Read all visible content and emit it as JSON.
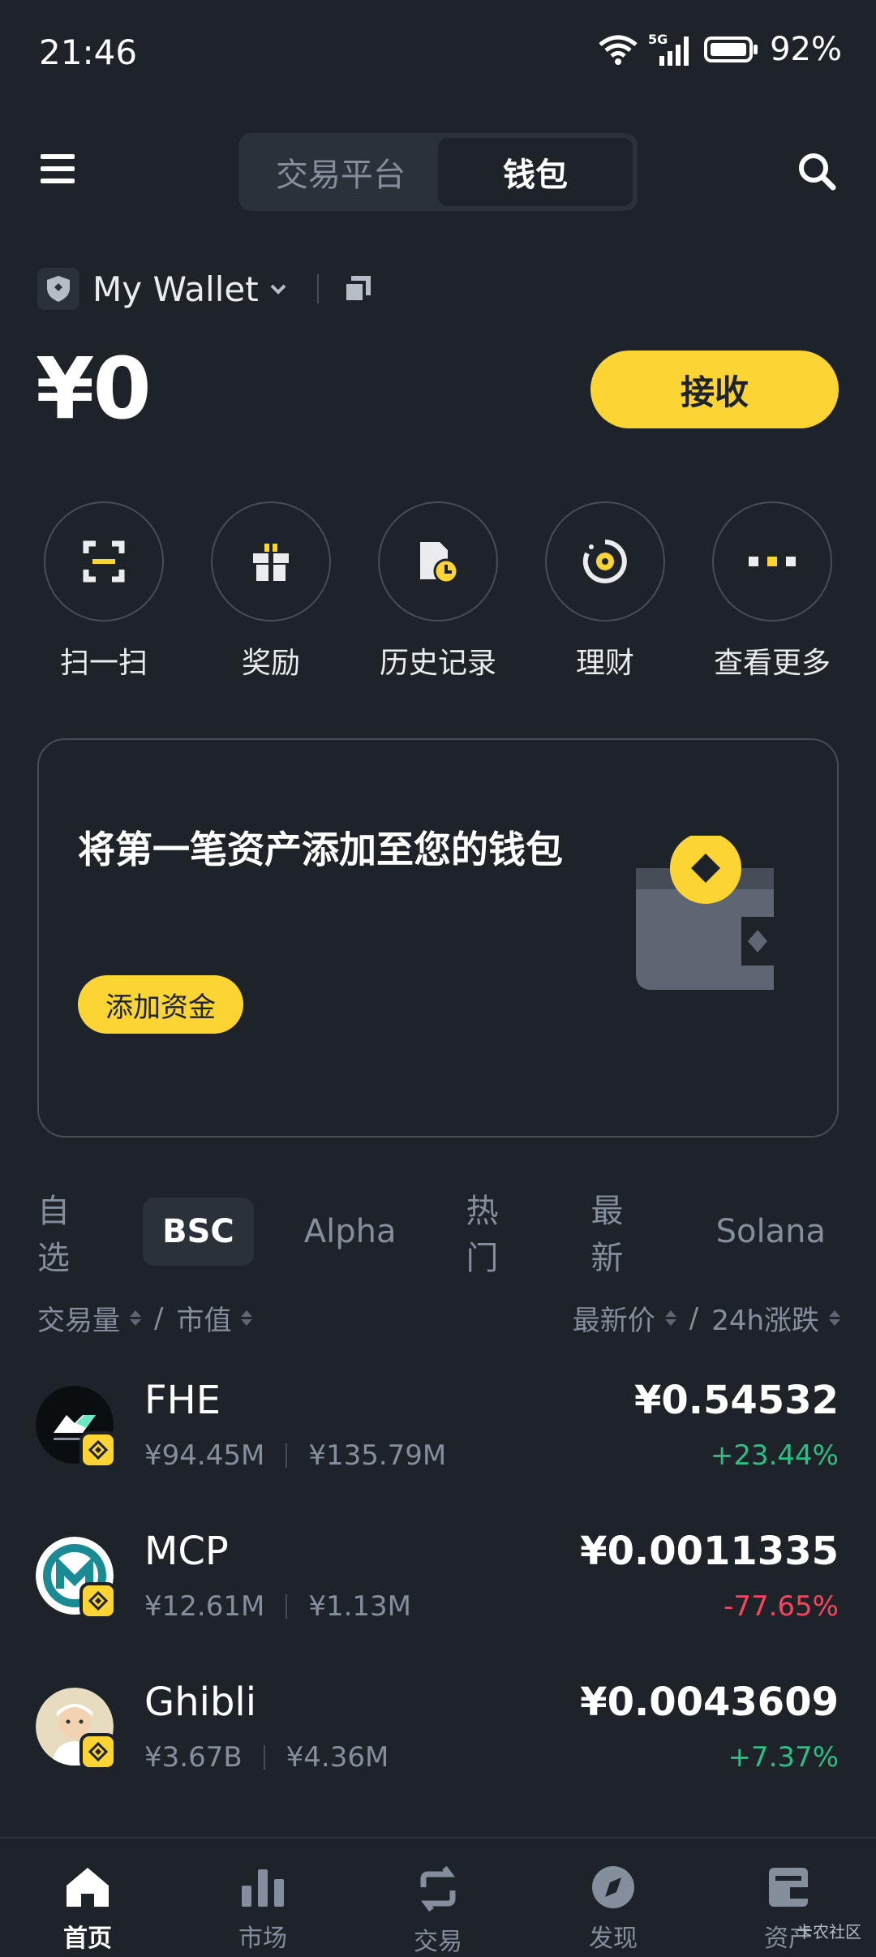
{
  "status_bar": {
    "time": "21:46",
    "network": "5G",
    "battery": "92%"
  },
  "header": {
    "tabs": [
      {
        "label": "交易平台"
      },
      {
        "label": "钱包"
      }
    ],
    "active_tab": "钱包"
  },
  "wallet": {
    "name": "My Wallet",
    "balance": "¥0",
    "receive_label": "接收"
  },
  "actions": [
    {
      "label": "扫一扫",
      "icon": "scan-icon"
    },
    {
      "label": "奖励",
      "icon": "gift-icon"
    },
    {
      "label": "历史记录",
      "icon": "history-icon"
    },
    {
      "label": "理财",
      "icon": "earn-icon"
    },
    {
      "label": "查看更多",
      "icon": "more-icon"
    }
  ],
  "promo_card": {
    "title": "将第一笔资产添加至您的钱包",
    "button": "添加资金"
  },
  "market_tabs": [
    {
      "label": "自选"
    },
    {
      "label": "BSC"
    },
    {
      "label": "Alpha"
    },
    {
      "label": "热门"
    },
    {
      "label": "最新"
    },
    {
      "label": "Solana"
    }
  ],
  "active_market_tab": "BSC",
  "sort_header": {
    "volume": "交易量",
    "mcap": "市值",
    "price": "最新价",
    "change": "24h涨跌"
  },
  "tokens": [
    {
      "name": "FHE",
      "volume": "¥94.45M",
      "mcap": "¥135.79M",
      "price": "¥0.54532",
      "change": "+23.44%",
      "direction": "up"
    },
    {
      "name": "MCP",
      "volume": "¥12.61M",
      "mcap": "¥1.13M",
      "price": "¥0.0011335",
      "change": "-77.65%",
      "direction": "down"
    },
    {
      "name": "Ghibli",
      "volume": "¥3.67B",
      "mcap": "¥4.36M",
      "price": "¥0.0043609",
      "change": "+7.37%",
      "direction": "up"
    }
  ],
  "bottom_nav": [
    {
      "label": "首页",
      "icon": "home-icon"
    },
    {
      "label": "市场",
      "icon": "market-icon"
    },
    {
      "label": "交易",
      "icon": "trade-icon"
    },
    {
      "label": "发现",
      "icon": "discover-icon"
    },
    {
      "label": "资产",
      "icon": "assets-icon"
    }
  ],
  "watermark": "卡农社区",
  "colors": {
    "background": "#1e2329",
    "accent": "#fcd535",
    "up": "#2ebd85",
    "down": "#f6465d"
  }
}
